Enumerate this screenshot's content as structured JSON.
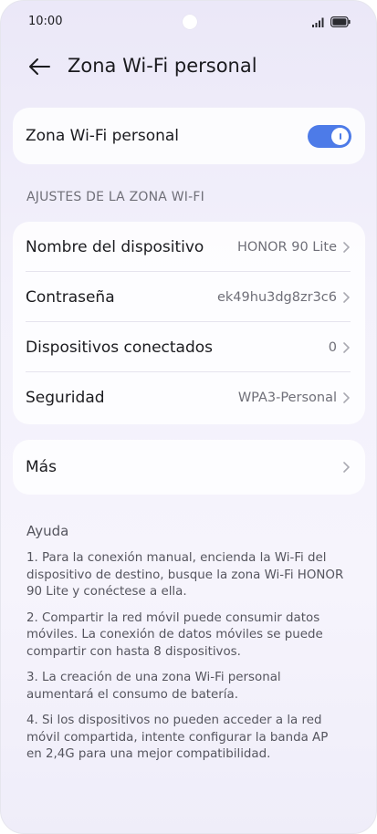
{
  "status_bar": {
    "time": "10:00"
  },
  "header": {
    "title": "Zona Wi-Fi personal"
  },
  "hotspot": {
    "label": "Zona Wi-Fi personal",
    "enabled": true
  },
  "settings_section": {
    "title": "AJUSTES DE LA ZONA WI-FI",
    "items": [
      {
        "label": "Nombre del dispositivo",
        "value": "HONOR 90 Lite"
      },
      {
        "label": "Contraseña",
        "value": "ek49hu3dg8zr3c6"
      },
      {
        "label": "Dispositivos conectados",
        "value": "0"
      },
      {
        "label": "Seguridad",
        "value": "WPA3-Personal"
      }
    ]
  },
  "more": {
    "label": "Más"
  },
  "help": {
    "title": "Ayuda",
    "items": [
      "1. Para la conexión manual, encienda la Wi-Fi del dispositivo de destino, busque la zona Wi-Fi HONOR 90 Lite y conéctese a ella.",
      "2. Compartir la red móvil puede consumir datos móviles. La conexión de datos móviles se puede compartir con hasta 8 dispositivos.",
      "3. La creación de una zona Wi-Fi personal aumentará el consumo de batería.",
      "4. Si los dispositivos no pueden acceder a la red móvil compartida, intente configurar la banda AP en 2,4G para una mejor compatibilidad."
    ]
  },
  "colors": {
    "accent": "#4d7be8",
    "background": "#f3f1fb"
  }
}
